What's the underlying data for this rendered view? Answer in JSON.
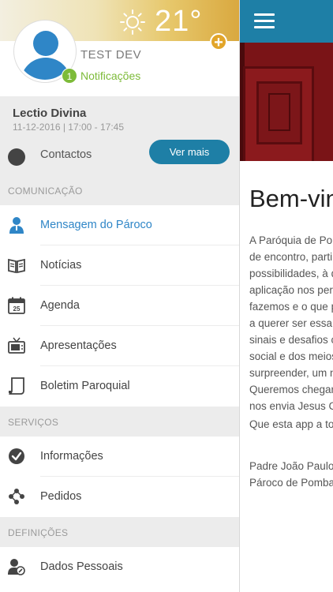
{
  "header": {
    "temperature": "21°",
    "username": "TEST DEV",
    "notifications_count": "1",
    "notifications_label": "Notificações",
    "add_symbol": "+"
  },
  "event": {
    "title": "Lectio Divina",
    "datetime": "11-12-2016 | 17:00 - 17:45",
    "partial_item": "Contactos",
    "more_button": "Ver mais"
  },
  "sections": {
    "comunicacao": "COMUNICAÇÃO",
    "servicos": "SERVIÇOS",
    "definicoes": "DEFINIÇÕES"
  },
  "menu": {
    "mensagem": "Mensagem do Pároco",
    "noticias": "Notícias",
    "agenda": "Agenda",
    "agenda_day": "25",
    "apresentacoes": "Apresentações",
    "boletim": "Boletim Paroquial",
    "informacoes": "Informações",
    "pedidos": "Pedidos",
    "dados": "Dados Pessoais"
  },
  "content": {
    "welcome": "Bem-vin",
    "lines": [
      "A Paróquia de Pom",
      "de encontro, parti",
      "possibilidades, à d",
      "aplicação nos per",
      "fazemos e o que p",
      "a querer ser essa",
      "sinais e desafios c",
      "social e dos meios",
      "surpreender, um n",
      "Queremos chegar",
      "nos envia Jesus C"
    ],
    "closing": "Que esta app a to",
    "signature": [
      "Padre João Paulo",
      "Pároco de Pomba"
    ]
  },
  "colors": {
    "accent": "#1e7fa6",
    "active_text": "#2f86c7",
    "notification_green": "#7dbb39",
    "add_orange": "#e2a52a"
  }
}
